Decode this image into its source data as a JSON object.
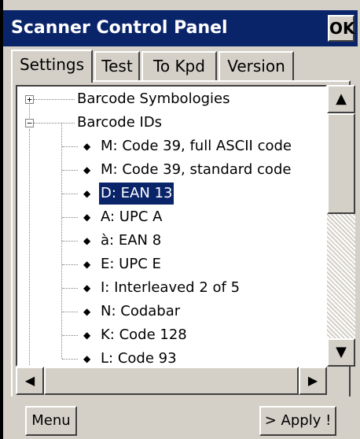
{
  "window": {
    "title": "Scanner Control Panel",
    "ok_label": "OK"
  },
  "tabs": [
    {
      "label": "Settings"
    },
    {
      "label": "Test"
    },
    {
      "label": "To Kpd"
    },
    {
      "label": "Version"
    }
  ],
  "tree": {
    "items": [
      {
        "label": "Barcode Symbologies",
        "expander": "+"
      },
      {
        "label": "Barcode IDs",
        "expander": "−"
      },
      {
        "label": "M: Code 39, full ASCII code"
      },
      {
        "label": "M: Code 39, standard code"
      },
      {
        "label": "D: EAN 13",
        "selected": true
      },
      {
        "label": "A: UPC A"
      },
      {
        "label": "à: EAN 8"
      },
      {
        "label": "E: UPC E"
      },
      {
        "label": "I: Interleaved 2 of 5"
      },
      {
        "label": "N: Codabar"
      },
      {
        "label": "K: Code 128"
      },
      {
        "label": "L: Code 93"
      }
    ]
  },
  "scroll": {
    "up_glyph": "▲",
    "down_glyph": "▼",
    "left_glyph": "◀",
    "right_glyph": "▶"
  },
  "buttons": {
    "menu_label": "Menu",
    "apply_label": "> Apply !"
  }
}
